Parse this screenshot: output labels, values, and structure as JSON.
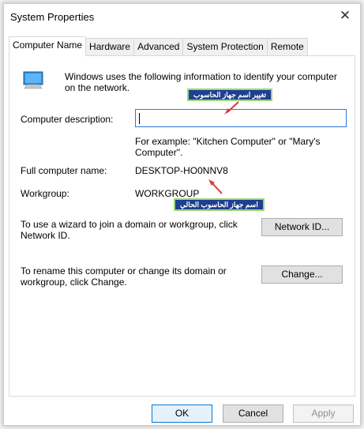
{
  "window": {
    "title": "System Properties"
  },
  "tabs": [
    {
      "label": "Computer Name"
    },
    {
      "label": "Hardware"
    },
    {
      "label": "Advanced"
    },
    {
      "label": "System Protection"
    },
    {
      "label": "Remote"
    }
  ],
  "computer_name_tab": {
    "intro_line1": "Windows uses the following information to identify your computer",
    "intro_line2": "on the network.",
    "description_label": "Computer description:",
    "description_value": "",
    "example_line1": "For example: \"Kitchen Computer\" or \"Mary's",
    "example_line2": "Computer\".",
    "full_name_label": "Full computer name:",
    "full_name_value": "DESKTOP-HO0NNV8",
    "workgroup_label": "Workgroup:",
    "workgroup_value": "WORKGROUP",
    "network_text_line1": "To use a wizard to join a domain or workgroup, click",
    "network_text_line2": "Network ID.",
    "network_button": "Network ID...",
    "rename_text_line1": "To rename this computer or change its domain or",
    "rename_text_line2": "workgroup, click Change.",
    "change_button": "Change..."
  },
  "annotations": {
    "change_name": "تغيير اسم جهاز الحاسوب",
    "current_name": "اسم جهاز الحاسوب الحالي",
    "color_box": "#1f3f8f",
    "color_border": "#9ad77b",
    "color_arrow": "#e0353a"
  },
  "footer": {
    "ok": "OK",
    "cancel": "Cancel",
    "apply": "Apply"
  }
}
